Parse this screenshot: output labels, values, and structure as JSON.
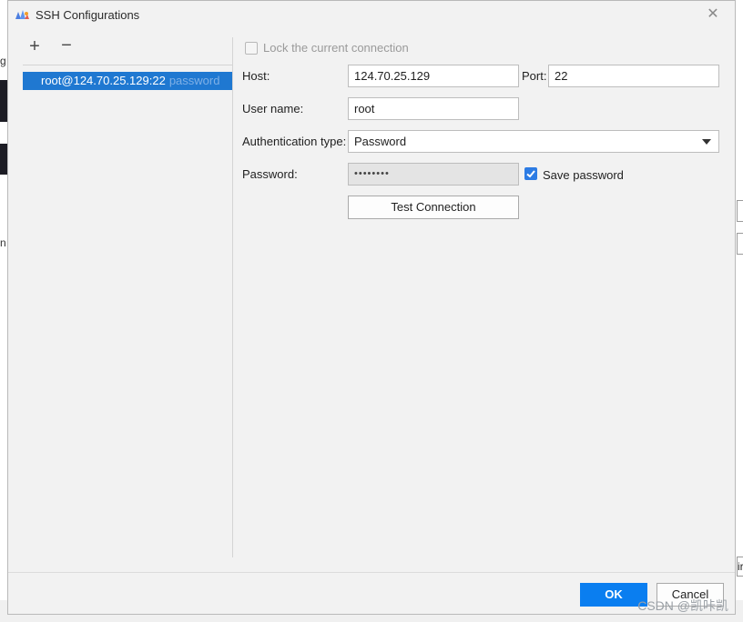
{
  "dialog": {
    "title": "SSH Configurations",
    "close_glyph": "✕"
  },
  "toolbar": {
    "add_glyph": "+",
    "remove_glyph": "−"
  },
  "config_list": [
    {
      "name": "root@124.70.25.129:22",
      "auth": "password",
      "selected": true
    }
  ],
  "form": {
    "lock_label": "Lock the current connection",
    "lock_checked": false,
    "host_label": "Host:",
    "host_value": "124.70.25.129",
    "port_label": "Port:",
    "port_value": "22",
    "user_label": "User name:",
    "user_value": "root",
    "auth_label": "Authentication type:",
    "auth_value": "Password",
    "password_label": "Password:",
    "password_value": "••••••••",
    "save_password_label": "Save password",
    "save_password_checked": true,
    "test_button": "Test Connection"
  },
  "footer": {
    "ok": "OK",
    "cancel": "Cancel"
  },
  "background": {
    "left_char_1": "g",
    "left_char_2": "n",
    "right_char": "ir"
  },
  "watermark": "CSDN @凯咔凯",
  "colors": {
    "accent": "#1f78d1",
    "ok_button": "#0a7ef0",
    "checkbox_checked": "#2d7ce4"
  }
}
